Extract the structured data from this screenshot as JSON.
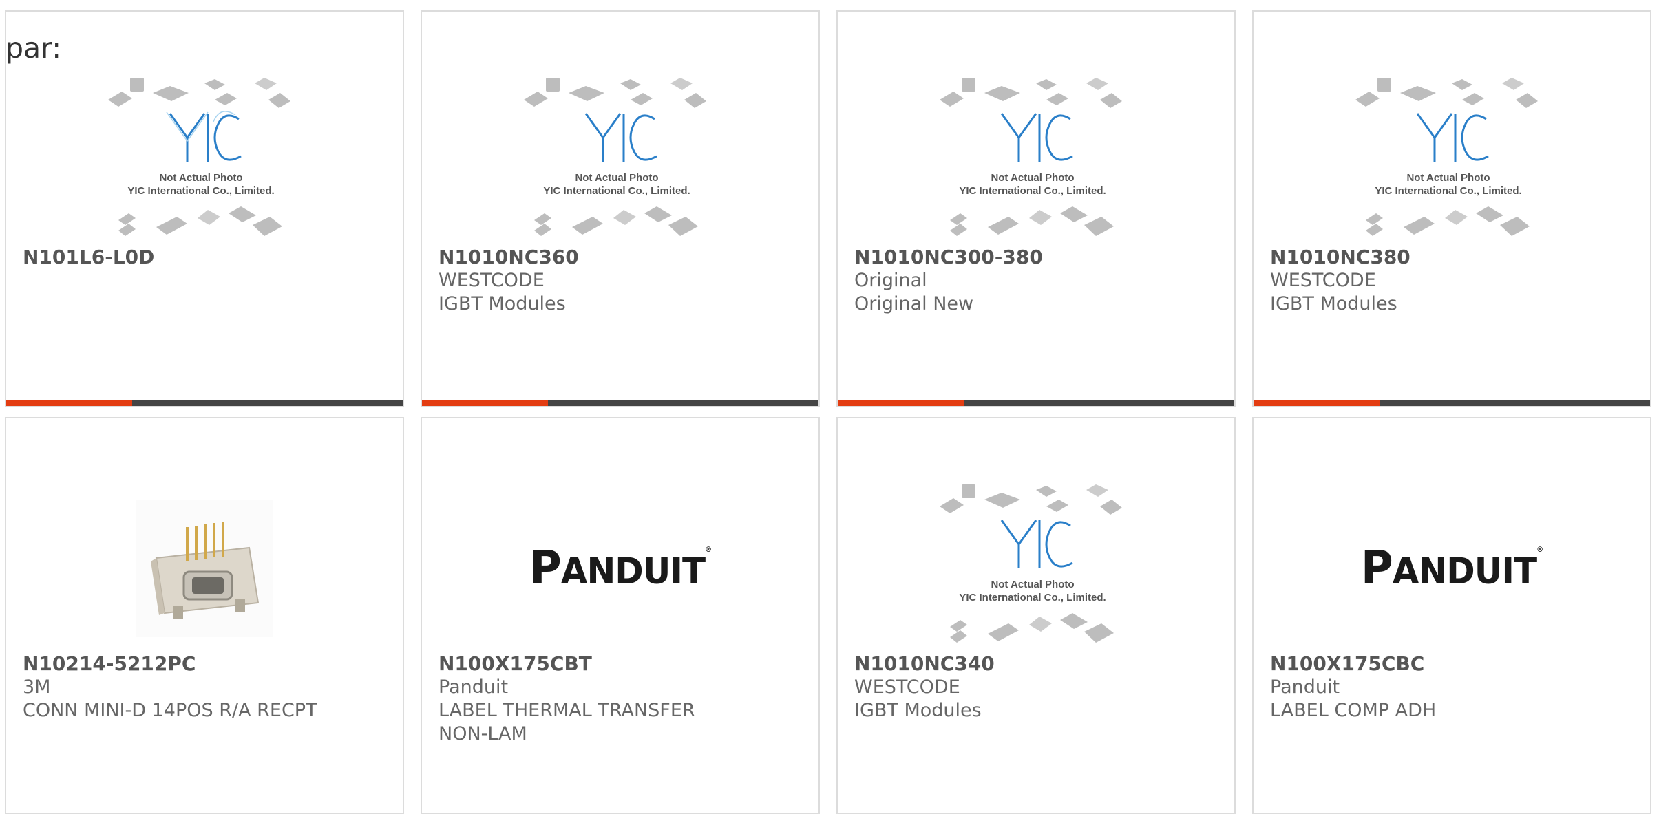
{
  "prefix_text": "par:",
  "placeholder": {
    "caption_line1": "Not Actual Photo",
    "caption_line2": "YIC International Co., Limited.",
    "logo_text": "YIC"
  },
  "panduit_logo": {
    "p": "P",
    "rest": "ANDUIT",
    "mark": "®"
  },
  "cards": [
    {
      "part": "N101L6-L0D",
      "maker": "",
      "desc": "",
      "desc2": "",
      "image": "yic-placeholder"
    },
    {
      "part": "N1010NC360",
      "maker": "WESTCODE",
      "desc": "IGBT Modules",
      "desc2": "",
      "image": "yic-placeholder"
    },
    {
      "part": "N1010NC300-380",
      "maker": "Original",
      "desc": "Original New",
      "desc2": "",
      "image": "yic-placeholder"
    },
    {
      "part": "N1010NC380",
      "maker": "WESTCODE",
      "desc": "IGBT Modules",
      "desc2": "",
      "image": "yic-placeholder"
    },
    {
      "part": "N10214-5212PC",
      "maker": "3M",
      "desc": "CONN MINI-D 14POS R/A RECPT",
      "desc2": "",
      "image": "connector-photo"
    },
    {
      "part": "N100X175CBT",
      "maker": "Panduit",
      "desc": "LABEL THERMAL TRANSFER",
      "desc2": "NON-LAM",
      "image": "panduit-logo"
    },
    {
      "part": "N1010NC340",
      "maker": "WESTCODE",
      "desc": "IGBT Modules",
      "desc2": "",
      "image": "yic-placeholder"
    },
    {
      "part": "N100X175CBC",
      "maker": "Panduit",
      "desc": "LABEL COMP ADH",
      "desc2": "",
      "image": "panduit-logo"
    }
  ],
  "colors": {
    "accent": "#e33d12",
    "bar": "#444444",
    "border": "#dcdcdc"
  }
}
